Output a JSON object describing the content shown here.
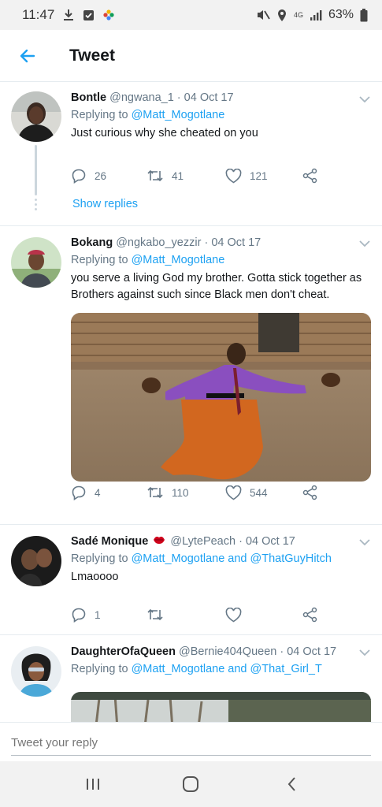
{
  "status_bar": {
    "time": "11:47",
    "battery": "63%",
    "network": "4G"
  },
  "header": {
    "title": "Tweet"
  },
  "tweets": [
    {
      "name": "Bontle",
      "handle": "@ngwana_1",
      "sep": " · ",
      "date": "04 Oct 17",
      "replying_prefix": "Replying to ",
      "mentions": "@Matt_Mogotlane",
      "text": "Just curious why she cheated on you",
      "replies": "26",
      "retweets": "41",
      "likes": "121",
      "show_replies": "Show replies"
    },
    {
      "name": "Bokang",
      "handle": "@ngkabo_yezzir",
      "sep": " · ",
      "date": "04 Oct 17",
      "replying_prefix": "Replying to ",
      "mentions": "@Matt_Mogotlane",
      "text": "you serve a living God my brother. Gotta stick together as Brothers against such since Black men don't cheat.",
      "replies": "4",
      "retweets": "110",
      "likes": "544"
    },
    {
      "name": "Sadé Monique",
      "handle": "@LytePeach",
      "sep": " · ",
      "date": "04 Oct 17",
      "replying_prefix": "Replying to ",
      "mentions": "@Matt_Mogotlane and @ThatGuyHitch",
      "text": "Lmaoooo",
      "replies": "1"
    },
    {
      "name": "DaughterOfaQueen",
      "handle": "@Bernie404Queen",
      "sep": " · ",
      "date": "04 Oct 17",
      "replying_prefix": "Replying to ",
      "mentions": "@Matt_Mogotlane and @That_Girl_T"
    }
  ],
  "reply_bar": {
    "placeholder": "Tweet your reply"
  },
  "colors": {
    "accent": "#1da1f2",
    "muted": "#657786",
    "text": "#14171a"
  }
}
